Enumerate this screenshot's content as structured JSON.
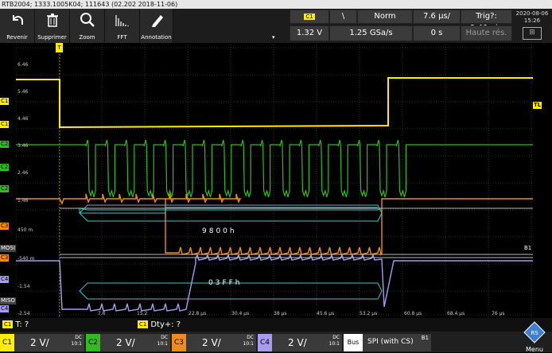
{
  "title_bar": "RTB2004; 1333.1005K04; 111643 (02.202 2018-11-06)",
  "toolbar": {
    "buttons": [
      {
        "label": "Revenir",
        "icon": "undo-icon"
      },
      {
        "label": "Supprimer",
        "icon": "trash-icon"
      },
      {
        "label": "Zoom",
        "icon": "zoom-icon"
      },
      {
        "label": "FFT",
        "icon": "fft-icon"
      },
      {
        "label": "Annotation",
        "icon": "annotation-icon"
      }
    ]
  },
  "trigger_panel": {
    "source": "C1",
    "slope_symbol": "\\",
    "mode": "Norm",
    "timebase": "7.6 µs/",
    "trigger_time": "Trig?: 9:40min",
    "level": "1.32 V",
    "sample_rate": "1.25 GSa/s",
    "offset": "0 s",
    "resolution": "Haute rés."
  },
  "clock": {
    "date": "2020-08-06",
    "time": "15:26"
  },
  "levels": [
    "6.46",
    "5.46",
    "4.46",
    "3.46",
    "2.46",
    "1.46",
    "450 m",
    "-540 m",
    "-1.54",
    "-2.54"
  ],
  "time_axis": [
    "7.6",
    "15.2",
    "22.8 µs",
    "30.4 µs",
    "38 µs",
    "45.6 µs",
    "53.2 µs",
    "60.8 µs",
    "68.4 µs",
    "76 µs"
  ],
  "channel_markers": {
    "c1": "C1",
    "c2": "C2",
    "c3": "C3",
    "c4": "C4",
    "mosi": "MOSI",
    "miso": "MISO",
    "b1": "B1",
    "tl": "TL"
  },
  "decode": {
    "mosi_value": "9800h",
    "miso_value": "03FFh"
  },
  "measurements": {
    "period": "T: ?",
    "duty": "Dty+: ?",
    "source": "C1"
  },
  "channels": [
    {
      "tag": "C1",
      "scale": "2 V/",
      "coupling": "DC",
      "bw": "10:1",
      "color": "#ffee00"
    },
    {
      "tag": "C2",
      "scale": "2 V/",
      "coupling": "DC",
      "bw": "10:1",
      "color": "#2fbd1d"
    },
    {
      "tag": "C3",
      "scale": "2 V/",
      "coupling": "DC",
      "bw": "10:1",
      "color": "#f28b19"
    },
    {
      "tag": "C4",
      "scale": "2 V/",
      "coupling": "DC",
      "bw": "10:1",
      "color": "#a89bf0"
    }
  ],
  "bus": {
    "label": "Bus",
    "protocol": "SPI (with CS)",
    "id": "B1"
  },
  "menu_label": "Menu",
  "colors": {
    "c1": "#ffee00",
    "c2": "#2fbd1d",
    "c3": "#f28b19",
    "c4": "#a89bf0",
    "miso_trace": "#6fc8f0",
    "bus": "#38c9c9"
  }
}
